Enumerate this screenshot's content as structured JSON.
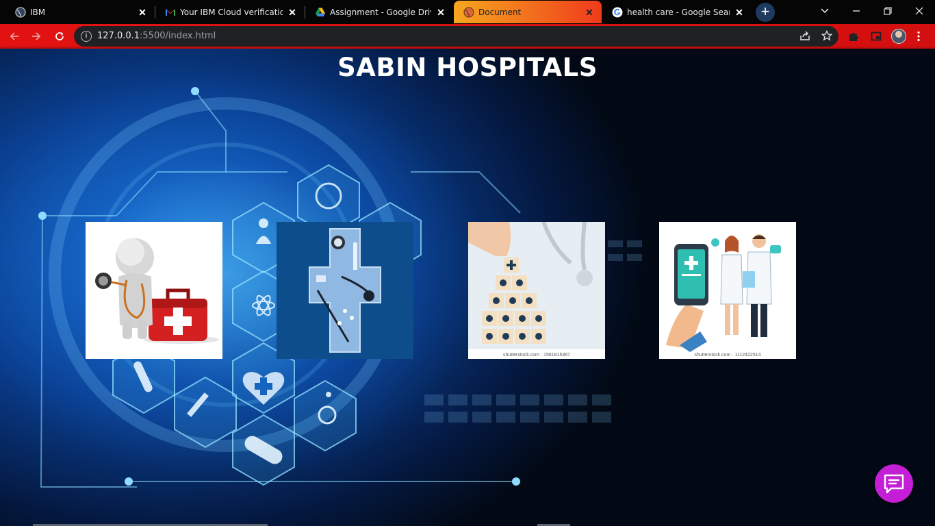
{
  "browser": {
    "tabs": [
      {
        "title": "IBM",
        "icon": "globe-icon"
      },
      {
        "title": "Your IBM Cloud verification c",
        "icon": "gmail-icon"
      },
      {
        "title": "Assignment - Google Drive",
        "icon": "google-drive-icon"
      },
      {
        "title": "Document",
        "icon": "globe-icon",
        "active": true
      },
      {
        "title": "health care - Google Search",
        "icon": "google-icon"
      }
    ],
    "url_host": "127.0.0.1",
    "url_rest": ":5500/index.html"
  },
  "page": {
    "title": "SABIN HOSPITALS",
    "cards": [
      {
        "alt": "3d figure with stethoscope and first aid kit"
      },
      {
        "alt": "medical cross with stethoscope"
      },
      {
        "alt": "hand stacking healthcare blocks",
        "caption": "shutterstock.com · 1561815367"
      },
      {
        "alt": "doctors with mobile medical app",
        "caption": "shutterstock.com · 1112422514"
      }
    ]
  },
  "colors": {
    "tab_active_start": "#f6a71f",
    "tab_active_end": "#ef3b1b",
    "toolbar": "#e21212",
    "chat_button": "#c41ed6"
  }
}
